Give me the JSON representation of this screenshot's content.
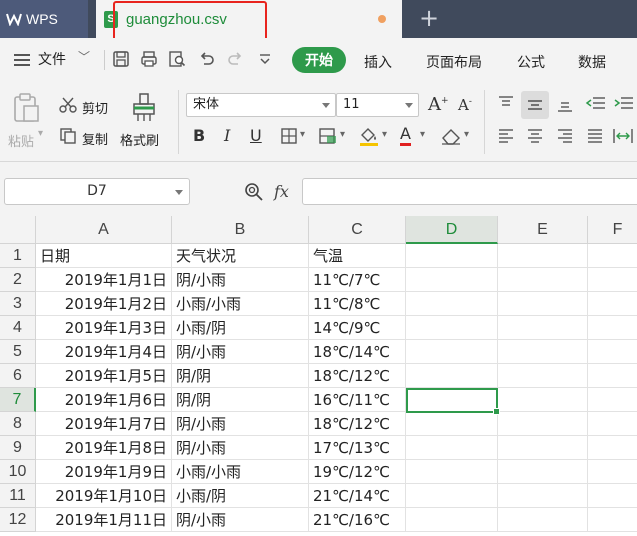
{
  "app": {
    "name": "WPS"
  },
  "tabs": {
    "active_file": "guangzhou.csv",
    "file_icon_letter": "S"
  },
  "menu": {
    "file": "文件",
    "items": [
      "开始",
      "插入",
      "页面布局",
      "公式",
      "数据"
    ]
  },
  "ribbon": {
    "paste": "粘贴",
    "cut": "剪切",
    "copy": "复制",
    "format_painter": "格式刷",
    "font_name": "宋体",
    "font_size": "11",
    "bold": "B",
    "italic": "I",
    "underline": "U",
    "font_color_letter": "A"
  },
  "formula_bar": {
    "name_box": "D7",
    "fx_label": "fx",
    "formula": ""
  },
  "colors": {
    "accent": "#2e9a4b",
    "title_bar": "#404a5c",
    "highlight": "#e8241e"
  },
  "sheet": {
    "columns": [
      "A",
      "B",
      "C",
      "D",
      "E",
      "F"
    ],
    "active_column": "D",
    "active_row": "7",
    "rows": [
      {
        "num": "1",
        "a": "日期",
        "b": "天气状况",
        "c": "气温"
      },
      {
        "num": "2",
        "a": "2019年1月1日",
        "b": "阴/小雨",
        "c": "11℃/7℃"
      },
      {
        "num": "3",
        "a": "2019年1月2日",
        "b": "小雨/小雨",
        "c": "11℃/8℃"
      },
      {
        "num": "4",
        "a": "2019年1月3日",
        "b": "小雨/阴",
        "c": "14℃/9℃"
      },
      {
        "num": "5",
        "a": "2019年1月4日",
        "b": "阴/小雨",
        "c": "18℃/14℃"
      },
      {
        "num": "6",
        "a": "2019年1月5日",
        "b": "阴/阴",
        "c": "18℃/12℃"
      },
      {
        "num": "7",
        "a": "2019年1月6日",
        "b": "阴/阴",
        "c": "16℃/11℃"
      },
      {
        "num": "8",
        "a": "2019年1月7日",
        "b": "阴/小雨",
        "c": "18℃/12℃"
      },
      {
        "num": "9",
        "a": "2019年1月8日",
        "b": "阴/小雨",
        "c": "17℃/13℃"
      },
      {
        "num": "10",
        "a": "2019年1月9日",
        "b": "小雨/小雨",
        "c": "19℃/12℃"
      },
      {
        "num": "11",
        "a": "2019年1月10日",
        "b": "小雨/阴",
        "c": "21℃/14℃"
      },
      {
        "num": "12",
        "a": "2019年1月11日",
        "b": "阴/小雨",
        "c": "21℃/16℃"
      }
    ]
  }
}
